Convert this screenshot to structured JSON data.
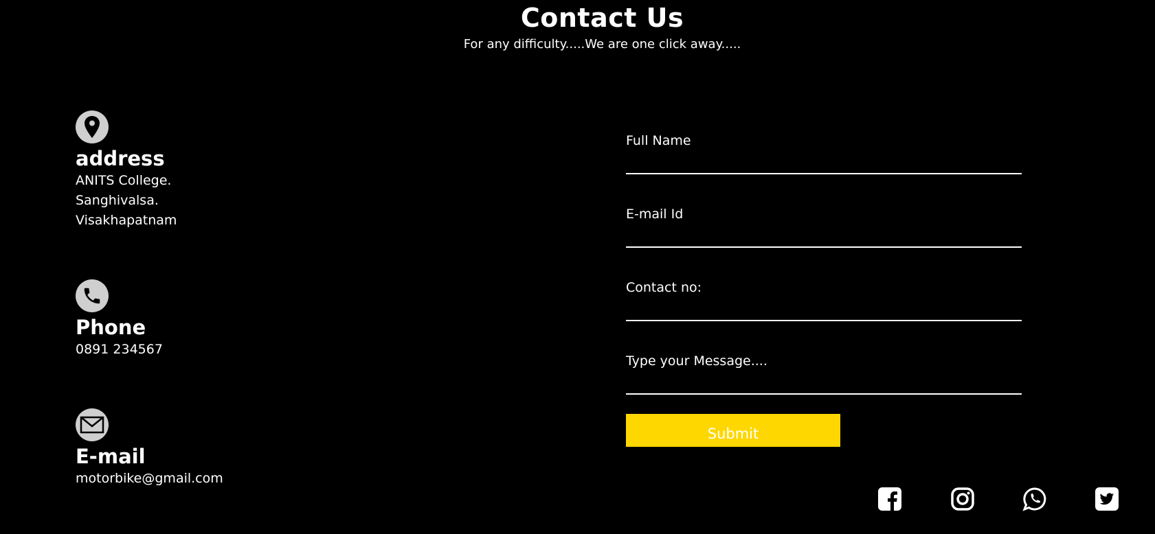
{
  "header": {
    "title": "Contact Us",
    "subtitle": "For any difficulty.....We are one click away....."
  },
  "contact_info": {
    "address": {
      "icon": "map-pin-icon",
      "heading": "address",
      "lines": [
        "ANITS College.",
        "Sanghivalsa.",
        "Visakhapatnam"
      ]
    },
    "phone": {
      "icon": "phone-icon",
      "heading": "Phone",
      "value": "0891 234567"
    },
    "email": {
      "icon": "mail-icon",
      "heading": "E-mail",
      "value": "motorbike@gmail.com"
    }
  },
  "form": {
    "fields": [
      {
        "label": "Full Name",
        "value": ""
      },
      {
        "label": "E-mail Id",
        "value": ""
      },
      {
        "label": "Contact no:",
        "value": ""
      },
      {
        "label": "Type your Message....",
        "value": ""
      }
    ],
    "submit_label": "Submit"
  },
  "social": [
    {
      "icon": "facebook-icon"
    },
    {
      "icon": "instagram-icon"
    },
    {
      "icon": "whatsapp-icon"
    },
    {
      "icon": "twitter-icon"
    }
  ],
  "colors": {
    "background": "#000000",
    "text": "#ffffff",
    "accent": "#ffd700",
    "icon_circle": "#cfcfcf"
  }
}
